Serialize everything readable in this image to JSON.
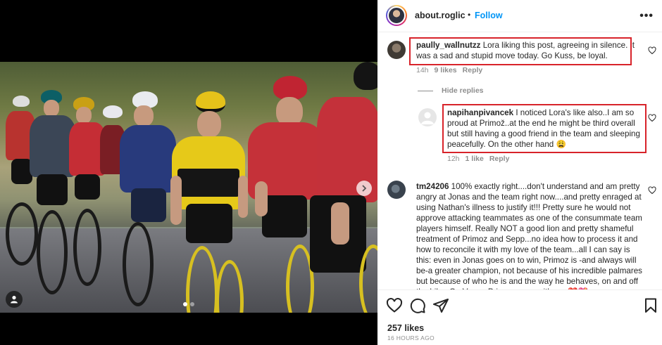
{
  "post": {
    "author": "about.roglic",
    "separator": "•",
    "follow_label": "Follow",
    "more_label": "•••"
  },
  "comments": [
    {
      "username": "paully_wallnutzz",
      "text": "Lora liking this post, agreeing in silence. It was a sad and stupid move today. Go Kuss, be loyal.",
      "time": "14h",
      "likes": "9 likes",
      "reply_label": "Reply"
    },
    {
      "username": "napihanpivancek",
      "text": "I noticed Lora's like also..I am so proud at Primož..at the end he might be third overall but still having a good friend in the team and sleeping peacefully. On the other hand 😩",
      "time": "12h",
      "likes": "1 like",
      "reply_label": "Reply"
    },
    {
      "username": "tm24206",
      "text": "100% exactly right....don't understand and am pretty angry at Jonas and the team right now....and pretty enraged at using Nathan's illness to justify it!!! Pretty sure he would not approve attacking teammates as one of the consummate team players himself. Really NOT a good lion and pretty shameful treatment of Primoz and Sepp...no idea how to process it and how to reconcile it with my love of the team...all I can say is this: even in Jonas goes on to win, Primoz is -and always will be-a greater champion, not because of his incredible palmares but because of who he is and the way he behaves, on and off the bike. Go Vegan Primoz...now with me ❤️💖"
    }
  ],
  "hide_replies_label": "Hide replies",
  "stats": {
    "likes": "257 likes",
    "time_ago": "16 HOURS AGO"
  },
  "icons": {
    "like": "heart-icon",
    "comment": "comment-icon",
    "share": "paper-plane-icon",
    "save": "bookmark-icon",
    "next": "chevron-right-icon",
    "tags": "user-tag-icon"
  },
  "colors": {
    "follow": "#0095f6",
    "highlight_box": "#d8232a",
    "muted": "#8e8e8e"
  }
}
